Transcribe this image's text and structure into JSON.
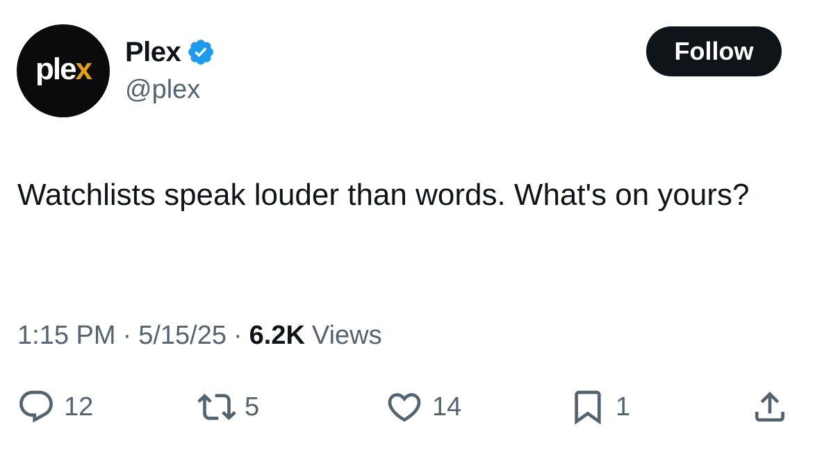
{
  "author": {
    "display_name": "Plex",
    "handle": "@plex",
    "avatar_logo_main": "ple",
    "avatar_logo_accent": "x",
    "verified": true
  },
  "follow_button": {
    "label": "Follow"
  },
  "tweet": {
    "text": "Watchlists speak louder than words. What's on yours?"
  },
  "meta": {
    "time": "1:15 PM",
    "separator": "·",
    "date": "5/15/25",
    "views_count": "6.2K",
    "views_label": "Views"
  },
  "actions": {
    "replies": "12",
    "retweets": "5",
    "likes": "14",
    "bookmarks": "1"
  },
  "colors": {
    "text_primary": "#0f1419",
    "text_secondary": "#536471",
    "verified_blue": "#1d9bf0",
    "plex_accent": "#e5a00d",
    "follow_bg": "#0f1419"
  }
}
